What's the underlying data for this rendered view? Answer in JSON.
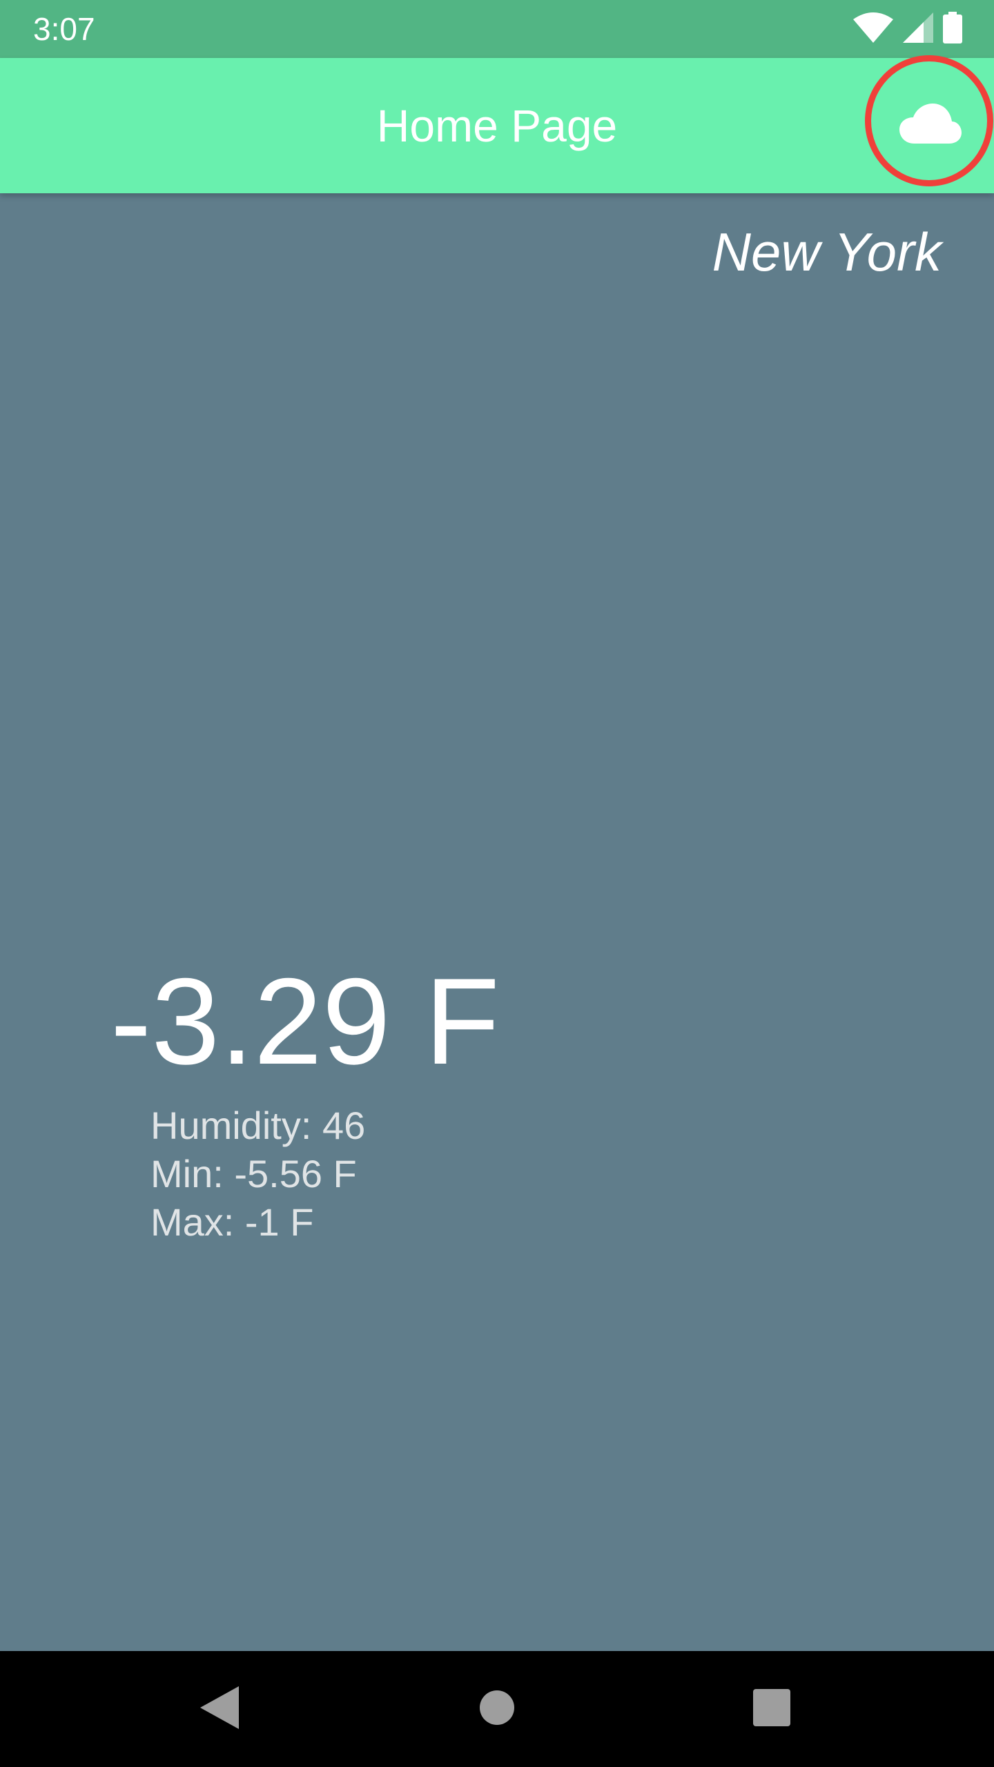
{
  "status_bar": {
    "time": "3:07",
    "icons": [
      "wifi-icon",
      "cell-signal-icon",
      "battery-icon"
    ]
  },
  "app_bar": {
    "title": "Home Page",
    "action_icon": "cloud-icon",
    "highlighted_action": "cloud-icon"
  },
  "weather": {
    "city": "New York",
    "temperature": "-3.29 F",
    "humidity": "Humidity: 46",
    "min": "Min: -5.56 F",
    "max": "Max: -1 F"
  },
  "nav_bar": {
    "buttons": [
      "back-icon",
      "home-icon",
      "recents-icon"
    ]
  },
  "colors": {
    "status_bar": "#52B584",
    "app_bar": "#69F0AE",
    "background": "#607D8B",
    "highlight": "#F0403A"
  }
}
